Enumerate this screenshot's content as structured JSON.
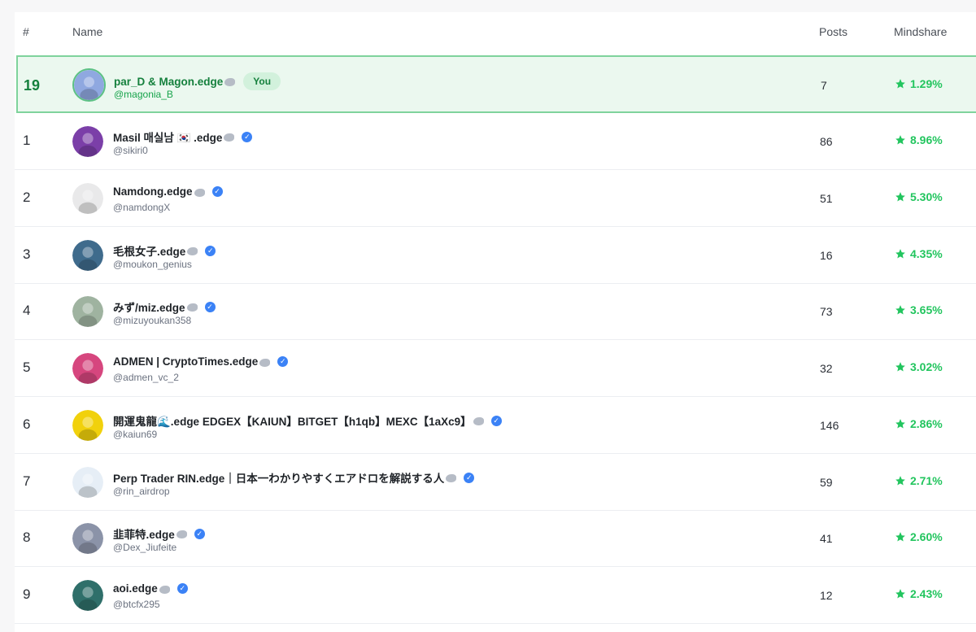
{
  "header": {
    "rank": "#",
    "name": "Name",
    "posts": "Posts",
    "mindshare": "Mindshare"
  },
  "you_badge": "You",
  "rows": [
    {
      "rank": "19",
      "name": "par_D & Magon.edge",
      "handle": "@magonia_B",
      "posts": "7",
      "mindshare": "1.29%",
      "is_me": true,
      "verified": false,
      "avatar_color": "#8fa8e0"
    },
    {
      "rank": "1",
      "name": "Masil 매실남 🇰🇷 .edge",
      "handle": "@sikiri0",
      "posts": "86",
      "mindshare": "8.96%",
      "is_me": false,
      "verified": true,
      "avatar_color": "#7b3fa8"
    },
    {
      "rank": "2",
      "name": "Namdong.edge",
      "handle": "@namdongX",
      "posts": "51",
      "mindshare": "5.30%",
      "is_me": false,
      "verified": true,
      "avatar_color": "#e9e9ea"
    },
    {
      "rank": "3",
      "name": "毛根女子.edge",
      "handle": "@moukon_genius",
      "posts": "16",
      "mindshare": "4.35%",
      "is_me": false,
      "verified": true,
      "avatar_color": "#3f6b8c"
    },
    {
      "rank": "4",
      "name": "みず/miz.edge",
      "handle": "@mizuyoukan358",
      "posts": "73",
      "mindshare": "3.65%",
      "is_me": false,
      "verified": true,
      "avatar_color": "#9fb3a0"
    },
    {
      "rank": "5",
      "name": "ADMEN | CryptoTimes.edge",
      "handle": "@admen_vc_2",
      "posts": "32",
      "mindshare": "3.02%",
      "is_me": false,
      "verified": true,
      "avatar_color": "#d6467e"
    },
    {
      "rank": "6",
      "name": "開運鬼龍🌊.edge EDGEX【KAIUN】BITGET【h1qb】MEXC【1aXc9】",
      "handle": "@kaiun69",
      "posts": "146",
      "mindshare": "2.86%",
      "is_me": false,
      "verified": true,
      "avatar_color": "#f1d10c"
    },
    {
      "rank": "7",
      "name": "Perp Trader RIN.edge｜日本一わかりやすくエアドロを解説する人",
      "handle": "@rin_airdrop",
      "posts": "59",
      "mindshare": "2.71%",
      "is_me": false,
      "verified": true,
      "avatar_color": "#e6eef6"
    },
    {
      "rank": "8",
      "name": "韭菲特.edge",
      "handle": "@Dex_Jiufeite",
      "posts": "41",
      "mindshare": "2.60%",
      "is_me": false,
      "verified": true,
      "avatar_color": "#8b93a8"
    },
    {
      "rank": "9",
      "name": "aoi.edge",
      "handle": "@btcfx295",
      "posts": "12",
      "mindshare": "2.43%",
      "is_me": false,
      "verified": true,
      "avatar_color": "#2f6f6a"
    }
  ]
}
